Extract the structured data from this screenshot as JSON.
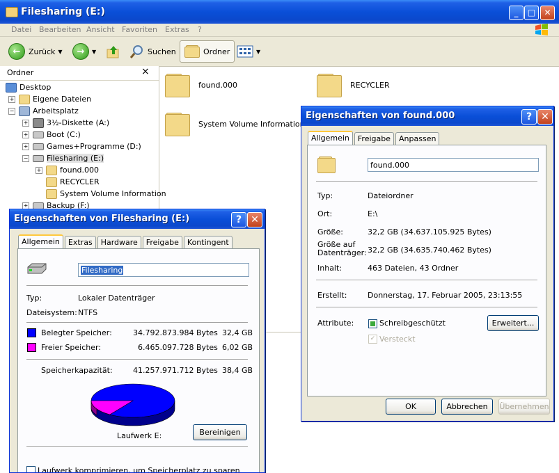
{
  "explorer": {
    "title": "Filesharing (E:)",
    "menu": [
      "Datei",
      "Bearbeiten",
      "Ansicht",
      "Favoriten",
      "Extras",
      "?"
    ],
    "toolbar": {
      "back": "Zurück",
      "search": "Suchen",
      "folders": "Ordner"
    },
    "tree": {
      "header": "Ordner",
      "close": "×",
      "items": [
        "Desktop",
        "Eigene Dateien",
        "Arbeitsplatz",
        "3½-Diskette (A:)",
        "Boot (C:)",
        "Games+Programme (D:)",
        "Filesharing (E:)",
        "found.000",
        "RECYCLER",
        "System Volume Information",
        "Backup (F:)"
      ]
    },
    "content": [
      "found.000",
      "RECYCLER",
      "System Volume Information"
    ]
  },
  "drive_dialog": {
    "title": "Eigenschaften von Filesharing (E:)",
    "tabs": [
      "Allgemein",
      "Extras",
      "Hardware",
      "Freigabe",
      "Kontingent"
    ],
    "name_value": "Filesharing",
    "type_label": "Typ:",
    "type_value": "Lokaler Datenträger",
    "fs_label": "Dateisystem:",
    "fs_value": "NTFS",
    "used_label": "Belegter Speicher:",
    "used_bytes": "34.792.873.984 Bytes",
    "used_gb": "32,4 GB",
    "free_label": "Freier Speicher:",
    "free_bytes": "6.465.097.728 Bytes",
    "free_gb": "6,02 GB",
    "cap_label": "Speicherkapazität:",
    "cap_bytes": "41.257.971.712 Bytes",
    "cap_gb": "38,4 GB",
    "used_fraction": 0.843,
    "used_color": "#0000ff",
    "free_color": "#ff00ff",
    "drive_label": "Laufwerk E:",
    "cleanup_button": "Bereinigen",
    "compress_checkbox": "Laufwerk komprimieren, um Speicherplatz zu sparen"
  },
  "folder_dialog": {
    "title": "Eigenschaften von found.000",
    "tabs": [
      "Allgemein",
      "Freigabe",
      "Anpassen"
    ],
    "name_value": "found.000",
    "type_label": "Typ:",
    "type_value": "Dateiordner",
    "location_label": "Ort:",
    "location_value": "E:\\",
    "size_label": "Größe:",
    "size_value": "32,2 GB (34.637.105.925 Bytes)",
    "disk_size_label_1": "Größe auf",
    "disk_size_label_2": "Datenträger:",
    "disk_size_value": "32,2 GB (34.635.740.462 Bytes)",
    "contents_label": "Inhalt:",
    "contents_value": "463 Dateien, 43 Ordner",
    "created_label": "Erstellt:",
    "created_value": "Donnerstag, 17. Februar 2005, 23:13:55",
    "attributes_label": "Attribute:",
    "readonly_label": "Schreibgeschützt",
    "hidden_label": "Versteckt",
    "advanced_button": "Erweitert...",
    "ok_button": "OK",
    "cancel_button": "Abbrechen",
    "apply_button": "Übernehmen"
  }
}
